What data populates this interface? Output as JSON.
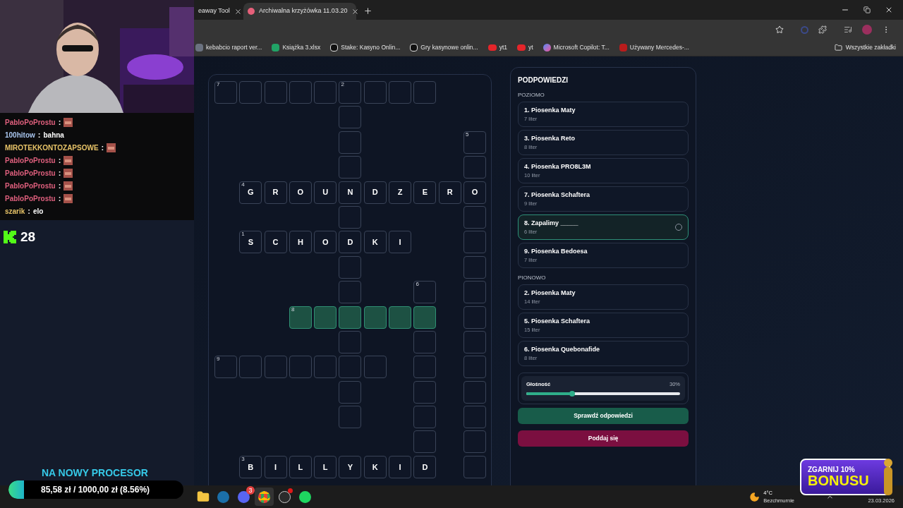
{
  "chat": [
    {
      "user": "PabloPoProstu",
      "separator": ":",
      "color": "#e0607e",
      "kind": "emote"
    },
    {
      "user": "100hitow",
      "separator": ":",
      "color": "#a9c6ee",
      "kind": "text",
      "text": "bahna"
    },
    {
      "user": "MIROTEKKONTOZAPSOWE",
      "separator": ":",
      "color": "#e8c468",
      "kind": "emote"
    },
    {
      "user": "PabloPoProstu",
      "separator": ":",
      "color": "#e0607e",
      "kind": "emote"
    },
    {
      "user": "PabloPoProstu",
      "separator": ":",
      "color": "#e0607e",
      "kind": "emote"
    },
    {
      "user": "PabloPoProstu",
      "separator": ":",
      "color": "#e0607e",
      "kind": "emote"
    },
    {
      "user": "PabloPoProstu",
      "separator": ":",
      "color": "#e0607e",
      "kind": "emote"
    },
    {
      "user": "szarik",
      "separator": ":",
      "color": "#e8c468",
      "kind": "text",
      "text": "elo"
    }
  ],
  "viewer_count": "28",
  "goal": {
    "title": "NA NOWY PROCESOR",
    "amount": "85,58 zł / 1000,00 zł (8.56%)",
    "level": 0.0856
  },
  "browser": {
    "tabs": [
      {
        "title": "eaway Tool",
        "selected": false
      },
      {
        "title": "Archiwalna krzyżówka 11.03.20",
        "selected": true
      }
    ],
    "bookmarks": [
      {
        "title": "kebabcio raport ver...",
        "kind": "page"
      },
      {
        "title": "Książka 3.xlsx",
        "kind": "sheet"
      },
      {
        "title": "Stake: Kasyno Onlin...",
        "kind": "s"
      },
      {
        "title": "Gry kasynowe onlin...",
        "kind": "s"
      },
      {
        "title": "yt1",
        "kind": "video"
      },
      {
        "title": "yt",
        "kind": "video"
      },
      {
        "title": "Microsoft Copilot: T...",
        "kind": "copilot"
      },
      {
        "title": "Używany Mercedes-...",
        "kind": "car"
      }
    ],
    "all_bookmarks": "Wszystkie zakładki"
  },
  "crossword": {
    "rows": [
      [
        {
          "kind": "cell",
          "number": "7",
          "selected": false
        },
        {
          "kind": "cell",
          "selected": false
        },
        {
          "kind": "cell",
          "selected": false
        },
        {
          "kind": "cell",
          "selected": false
        },
        {
          "kind": "cell",
          "selected": false
        },
        {
          "kind": "cell",
          "number": "2",
          "selected": false
        },
        {
          "kind": "cell",
          "selected": false
        },
        {
          "kind": "cell",
          "selected": false
        },
        {
          "kind": "cell",
          "selected": false
        },
        {
          "kind": "gap"
        },
        {
          "kind": "gap"
        }
      ],
      [
        {
          "kind": "gap"
        },
        {
          "kind": "gap"
        },
        {
          "kind": "gap"
        },
        {
          "kind": "gap"
        },
        {
          "kind": "gap"
        },
        {
          "kind": "cell",
          "selected": false
        },
        {
          "kind": "gap"
        },
        {
          "kind": "gap"
        },
        {
          "kind": "gap"
        },
        {
          "kind": "gap"
        },
        {
          "kind": "gap"
        }
      ],
      [
        {
          "kind": "gap"
        },
        {
          "kind": "gap"
        },
        {
          "kind": "gap"
        },
        {
          "kind": "gap"
        },
        {
          "kind": "gap"
        },
        {
          "kind": "cell",
          "selected": false
        },
        {
          "kind": "gap"
        },
        {
          "kind": "gap"
        },
        {
          "kind": "gap"
        },
        {
          "kind": "gap"
        },
        {
          "kind": "cell",
          "number": "5",
          "selected": false
        }
      ],
      [
        {
          "kind": "gap"
        },
        {
          "kind": "gap"
        },
        {
          "kind": "gap"
        },
        {
          "kind": "gap"
        },
        {
          "kind": "gap"
        },
        {
          "kind": "cell",
          "selected": false
        },
        {
          "kind": "gap"
        },
        {
          "kind": "gap"
        },
        {
          "kind": "gap"
        },
        {
          "kind": "gap"
        },
        {
          "kind": "cell",
          "selected": false
        }
      ],
      [
        {
          "kind": "gap"
        },
        {
          "kind": "cell",
          "number": "4",
          "letter": "G",
          "selected": false
        },
        {
          "kind": "cell",
          "letter": "R",
          "selected": false
        },
        {
          "kind": "cell",
          "letter": "O",
          "selected": false
        },
        {
          "kind": "cell",
          "letter": "U",
          "selected": false
        },
        {
          "kind": "cell",
          "letter": "N",
          "selected": false
        },
        {
          "kind": "cell",
          "letter": "D",
          "selected": false
        },
        {
          "kind": "cell",
          "letter": "Z",
          "selected": false
        },
        {
          "kind": "cell",
          "letter": "E",
          "selected": false
        },
        {
          "kind": "cell",
          "letter": "R",
          "selected": false
        },
        {
          "kind": "cell",
          "letter": "O",
          "selected": false
        }
      ],
      [
        {
          "kind": "gap"
        },
        {
          "kind": "gap"
        },
        {
          "kind": "gap"
        },
        {
          "kind": "gap"
        },
        {
          "kind": "gap"
        },
        {
          "kind": "cell",
          "selected": false
        },
        {
          "kind": "gap"
        },
        {
          "kind": "gap"
        },
        {
          "kind": "gap"
        },
        {
          "kind": "gap"
        },
        {
          "kind": "cell",
          "selected": false
        }
      ],
      [
        {
          "kind": "gap"
        },
        {
          "kind": "cell",
          "number": "1",
          "letter": "S",
          "selected": false
        },
        {
          "kind": "cell",
          "letter": "C",
          "selected": false
        },
        {
          "kind": "cell",
          "letter": "H",
          "selected": false
        },
        {
          "kind": "cell",
          "letter": "O",
          "selected": false
        },
        {
          "kind": "cell",
          "letter": "D",
          "selected": false
        },
        {
          "kind": "cell",
          "letter": "K",
          "selected": false
        },
        {
          "kind": "cell",
          "letter": "I",
          "selected": false
        },
        {
          "kind": "gap"
        },
        {
          "kind": "gap"
        },
        {
          "kind": "cell",
          "selected": false
        }
      ],
      [
        {
          "kind": "gap"
        },
        {
          "kind": "gap"
        },
        {
          "kind": "gap"
        },
        {
          "kind": "gap"
        },
        {
          "kind": "gap"
        },
        {
          "kind": "cell",
          "selected": false
        },
        {
          "kind": "gap"
        },
        {
          "kind": "gap"
        },
        {
          "kind": "gap"
        },
        {
          "kind": "gap"
        },
        {
          "kind": "cell",
          "selected": false
        }
      ],
      [
        {
          "kind": "gap"
        },
        {
          "kind": "gap"
        },
        {
          "kind": "gap"
        },
        {
          "kind": "gap"
        },
        {
          "kind": "gap"
        },
        {
          "kind": "cell",
          "selected": false
        },
        {
          "kind": "gap"
        },
        {
          "kind": "gap"
        },
        {
          "kind": "cell",
          "number": "6",
          "selected": false
        },
        {
          "kind": "gap"
        },
        {
          "kind": "cell",
          "selected": false
        }
      ],
      [
        {
          "kind": "gap"
        },
        {
          "kind": "gap"
        },
        {
          "kind": "gap"
        },
        {
          "kind": "cell",
          "number": "8",
          "selected": true
        },
        {
          "kind": "cell",
          "selected": true
        },
        {
          "kind": "cell",
          "selected": true
        },
        {
          "kind": "cell",
          "selected": true
        },
        {
          "kind": "cell",
          "selected": true
        },
        {
          "kind": "cell",
          "selected": true
        },
        {
          "kind": "gap"
        },
        {
          "kind": "cell",
          "selected": false
        }
      ],
      [
        {
          "kind": "gap"
        },
        {
          "kind": "gap"
        },
        {
          "kind": "gap"
        },
        {
          "kind": "gap"
        },
        {
          "kind": "gap"
        },
        {
          "kind": "cell",
          "selected": false
        },
        {
          "kind": "gap"
        },
        {
          "kind": "gap"
        },
        {
          "kind": "cell",
          "selected": false
        },
        {
          "kind": "gap"
        },
        {
          "kind": "cell",
          "selected": false
        }
      ],
      [
        {
          "kind": "cell",
          "number": "9",
          "selected": false
        },
        {
          "kind": "cell",
          "selected": false
        },
        {
          "kind": "cell",
          "selected": false
        },
        {
          "kind": "cell",
          "selected": false
        },
        {
          "kind": "cell",
          "selected": false
        },
        {
          "kind": "cell",
          "selected": false
        },
        {
          "kind": "cell",
          "selected": false
        },
        {
          "kind": "gap"
        },
        {
          "kind": "cell",
          "selected": false
        },
        {
          "kind": "gap"
        },
        {
          "kind": "cell",
          "selected": false
        }
      ],
      [
        {
          "kind": "gap"
        },
        {
          "kind": "gap"
        },
        {
          "kind": "gap"
        },
        {
          "kind": "gap"
        },
        {
          "kind": "gap"
        },
        {
          "kind": "cell",
          "selected": false
        },
        {
          "kind": "gap"
        },
        {
          "kind": "gap"
        },
        {
          "kind": "cell",
          "selected": false
        },
        {
          "kind": "gap"
        },
        {
          "kind": "cell",
          "selected": false
        }
      ],
      [
        {
          "kind": "gap"
        },
        {
          "kind": "gap"
        },
        {
          "kind": "gap"
        },
        {
          "kind": "gap"
        },
        {
          "kind": "gap"
        },
        {
          "kind": "cell",
          "selected": false
        },
        {
          "kind": "gap"
        },
        {
          "kind": "gap"
        },
        {
          "kind": "cell",
          "selected": false
        },
        {
          "kind": "gap"
        },
        {
          "kind": "cell",
          "selected": false
        }
      ],
      [
        {
          "kind": "gap"
        },
        {
          "kind": "gap"
        },
        {
          "kind": "gap"
        },
        {
          "kind": "gap"
        },
        {
          "kind": "gap"
        },
        {
          "kind": "gap"
        },
        {
          "kind": "gap"
        },
        {
          "kind": "gap"
        },
        {
          "kind": "cell",
          "selected": false
        },
        {
          "kind": "gap"
        },
        {
          "kind": "cell",
          "selected": false
        }
      ],
      [
        {
          "kind": "gap"
        },
        {
          "kind": "cell",
          "number": "3",
          "letter": "B",
          "selected": false
        },
        {
          "kind": "cell",
          "letter": "I",
          "selected": false
        },
        {
          "kind": "cell",
          "letter": "L",
          "selected": false
        },
        {
          "kind": "cell",
          "letter": "L",
          "selected": false
        },
        {
          "kind": "cell",
          "letter": "Y",
          "selected": false
        },
        {
          "kind": "cell",
          "letter": "K",
          "selected": false
        },
        {
          "kind": "cell",
          "letter": "I",
          "selected": false
        },
        {
          "kind": "cell",
          "letter": "D",
          "selected": false
        },
        {
          "kind": "gap"
        },
        {
          "kind": "cell",
          "selected": false
        }
      ]
    ]
  },
  "hints": {
    "title": "PODPOWIEDZI",
    "groups": [
      {
        "title": "POZIOMO",
        "items": [
          {
            "clue": "1. Piosenka Maty",
            "length": "7 liter",
            "selected": false
          },
          {
            "clue": "3. Piosenka Reto",
            "length": "8 liter",
            "selected": false
          },
          {
            "clue": "4. Piosenka PRO8L3M",
            "length": "10 liter",
            "selected": false
          },
          {
            "clue": "7. Piosenka Schaftera",
            "length": "9 liter",
            "selected": false
          },
          {
            "clue": "8. Zapalimy _____",
            "length": "6 liter",
            "selected": true
          },
          {
            "clue": "9. Piosenka Bedoesa",
            "length": "7 liter",
            "selected": false
          }
        ]
      },
      {
        "title": "PIONOWO",
        "items": [
          {
            "clue": "2. Piosenka Maty",
            "length": "14 liter",
            "selected": false
          },
          {
            "clue": "5. Piosenka Schaftera",
            "length": "15 liter",
            "selected": false
          },
          {
            "clue": "6. Piosenka Quebonafide",
            "length": "8 liter",
            "selected": false
          }
        ]
      }
    ],
    "volume": {
      "label": "Głośność",
      "reading": "30%",
      "level": 0.3
    },
    "buttons": [
      {
        "label": "Sprawdź odpowiedzi",
        "kind": "primary"
      },
      {
        "label": "Poddaj się",
        "kind": "danger"
      }
    ]
  },
  "taskbar": {
    "apps": [
      {
        "kind": "folder"
      },
      {
        "kind": "steam"
      },
      {
        "kind": "discord",
        "badge": "3"
      },
      {
        "kind": "chrome",
        "selected": true
      },
      {
        "kind": "obs",
        "alert": true
      },
      {
        "kind": "spotify"
      }
    ],
    "weather": {
      "temperature": "4°C",
      "condition": "Bezchmurnie"
    },
    "date": "23.03.2026"
  },
  "promo": {
    "line1": "ZGARNIJ 10%",
    "line2": "BONUSU"
  }
}
